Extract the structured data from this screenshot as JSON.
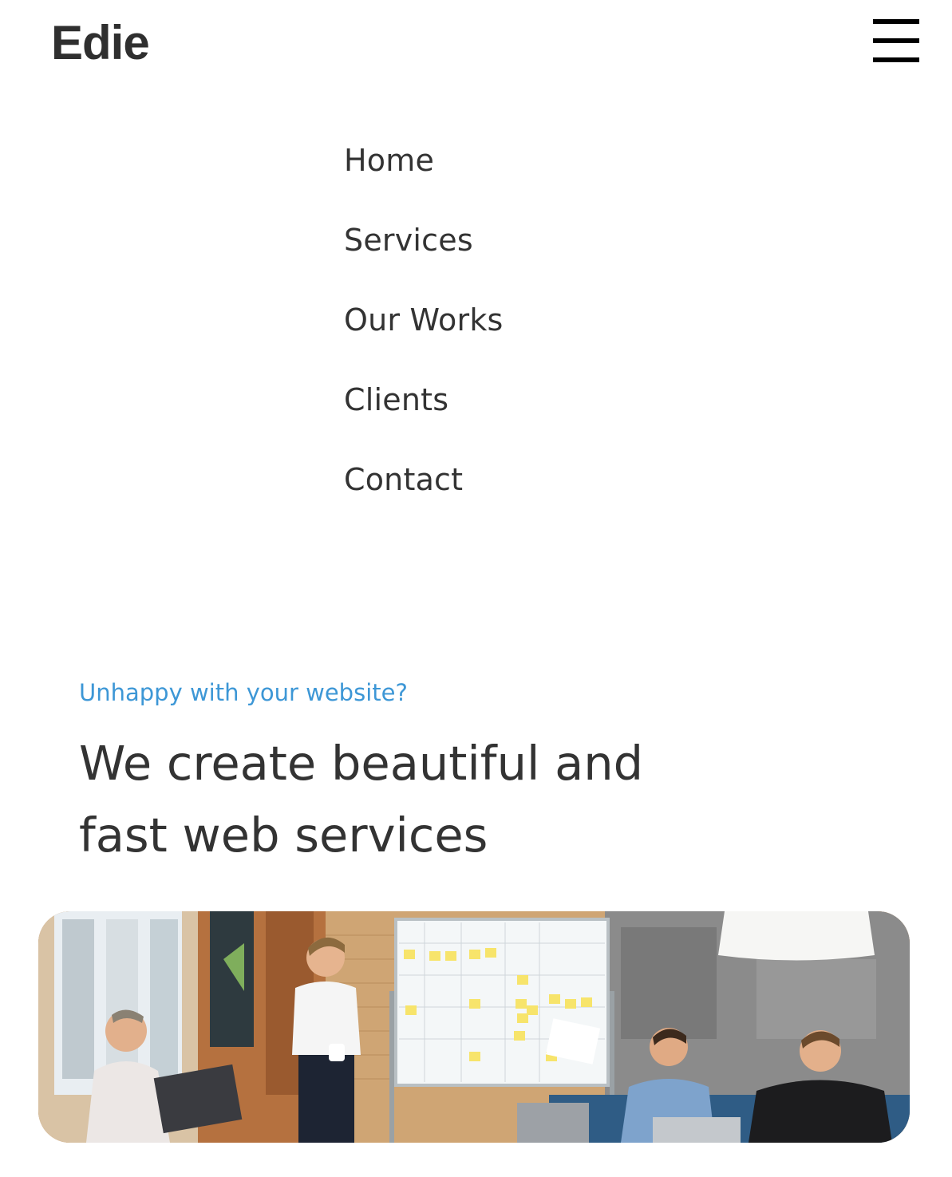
{
  "header": {
    "logo": "Edie",
    "menu_icon": "hamburger-menu-icon"
  },
  "nav": {
    "items": [
      {
        "label": "Home"
      },
      {
        "label": "Services"
      },
      {
        "label": "Our Works"
      },
      {
        "label": "Clients"
      },
      {
        "label": "Contact"
      }
    ]
  },
  "hero": {
    "eyebrow": "Unhappy with your website?",
    "title": "We create beautiful and fast web services",
    "image": "team-meeting-whiteboard-photo"
  },
  "colors": {
    "accent": "#3d97d6",
    "text": "#333333",
    "background": "#ffffff"
  }
}
